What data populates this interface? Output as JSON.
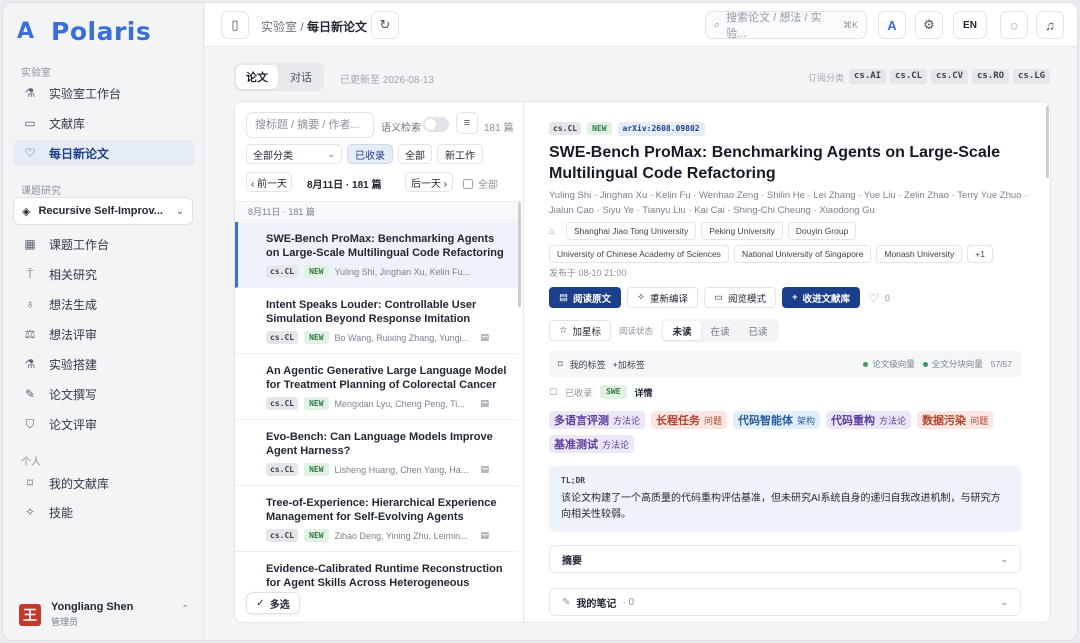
{
  "brand": {
    "name": "Polaris"
  },
  "sidebar": {
    "section_lab": "实验室",
    "lab_items": [
      {
        "label": "实验室工作台"
      },
      {
        "label": "文献库"
      },
      {
        "label": "每日新论文"
      }
    ],
    "section_research": "课题研究",
    "project": "Recursive Self-Improv...",
    "research_items": [
      {
        "label": "课题工作台"
      },
      {
        "label": "相关研究"
      },
      {
        "label": "想法生成"
      },
      {
        "label": "想法评审"
      },
      {
        "label": "实验搭建"
      },
      {
        "label": "论文撰写"
      },
      {
        "label": "论文评审"
      }
    ],
    "section_personal": "个人",
    "personal_items": [
      {
        "label": "我的文献库"
      },
      {
        "label": "技能"
      }
    ],
    "user": {
      "name": "Yongliang Shen",
      "role": "管理员"
    }
  },
  "topbar": {
    "breadcrumb_parent": "实验室",
    "breadcrumb_current": "每日新论文",
    "search_placeholder": "搜索论文 / 想法 / 实验...",
    "search_shortcut": "⌘K",
    "lang": "EN"
  },
  "main": {
    "tabs": [
      "论文",
      "对话"
    ],
    "updated": "已更新至 2026-08-13",
    "subscribed_label": "订阅分类",
    "subscribed": [
      "cs.AI",
      "cs.CL",
      "cs.CV",
      "cs.RO",
      "cs.LG"
    ]
  },
  "list": {
    "filter_placeholder": "搜标题 / 摘要 / 作者...",
    "semantic_label": "语义检索",
    "count": "181 篇",
    "category": "全部分类",
    "pills": [
      "已收录",
      "全部",
      "新工作"
    ],
    "prev_day": "‹ 前一天",
    "day_label": "8月11日 · 181 篇",
    "next_day": "后一天 ›",
    "all_label": "全部",
    "group_header": "8月11日 · 181 篇",
    "collected_button": "多选",
    "items": [
      {
        "title": "SWE-Bench ProMax: Benchmarking Agents on Large-Scale Multilingual Code Refactoring",
        "cat": "cs.CL",
        "tag": "NEW",
        "authors": "Yuling Shi, Jinghan Xu, Kelin Fu..."
      },
      {
        "title": "Intent Speaks Louder: Controllable User Simulation Beyond Response Imitation",
        "cat": "cs.CL",
        "tag": "NEW",
        "authors": "Bo Wang, Ruixing Zhang, Yungi..."
      },
      {
        "title": "An Agentic Generative Large Language Model for Treatment Planning of Colorectal Cancer",
        "cat": "cs.CL",
        "tag": "NEW",
        "authors": "Mengxian Lyu, Cheng Peng, Ti..."
      },
      {
        "title": "Evo-Bench: Can Language Models Improve Agent Harness?",
        "cat": "cs.CL",
        "tag": "NEW",
        "authors": "Lisheng Huang, Chen Yang, Ha..."
      },
      {
        "title": "Tree-of-Experience: Hierarchical Experience Management for Self-Evolving Agents",
        "cat": "cs.CL",
        "tag": "NEW",
        "authors": "Zihao Deng, Yining Zhu, Leimin..."
      },
      {
        "title": "Evidence-Calibrated Runtime Reconstruction for Agent Skills Across Heterogeneous Codin...",
        "cat": "",
        "tag": "",
        "authors": ""
      }
    ]
  },
  "detail": {
    "cat": "cs.CL",
    "tag_new": "NEW",
    "arxiv": "arXiv:2608.09802",
    "title": "SWE-Bench ProMax: Benchmarking Agents on Large-Scale Multilingual Code Refactoring",
    "authors": "Yuling Shi · Jinghan Xu · Kelin Fu · Wenhao Zeng · Shilin He · Lei Zhang · Yue Liu · Zelin Zhao · Terry Yue Zhuo · Jialun Cao · Siyu Ye · Tianyu Liu · Kai Cai · Shing-Chi Cheung · Xiaodong Gu",
    "affiliations": [
      "Shanghai Jiao Tong University",
      "Peking University",
      "Douyin Group",
      "University of Chinese Academy of Sciences",
      "National University of Singapore",
      "Monash University",
      "+1"
    ],
    "published": "发布于 08-10 21:00",
    "actions": {
      "read": "阅读原文",
      "recompile": "重新编译",
      "reader": "阅览模式",
      "add_library": "收进文献库",
      "likes": "0"
    },
    "star": "加星标",
    "read_status_label": "阅读状态",
    "read_status": [
      "未读",
      "在读",
      "已读"
    ],
    "my_tags": "我的标签",
    "add_tag": "+加标签",
    "vec_paper": "论文级向量",
    "vec_chunks": "全文分块向量",
    "chunks_count": "57/57",
    "collected_label": "已收录",
    "collected_tag": "SWE",
    "details_label": "详情",
    "concepts": [
      {
        "name": "多语言评测",
        "kind": "方法论",
        "bg": "#ece6f7",
        "fg": "#5b3f9c"
      },
      {
        "name": "长程任务",
        "kind": "问题",
        "bg": "#fbe6e3",
        "fg": "#b2432f"
      },
      {
        "name": "代码智能体",
        "kind": "架构",
        "bg": "#e2eef9",
        "fg": "#2a5f9e"
      },
      {
        "name": "代码重构",
        "kind": "方法论",
        "bg": "#ece6f7",
        "fg": "#5b3f9c"
      },
      {
        "name": "数据污染",
        "kind": "问题",
        "bg": "#fbe6e3",
        "fg": "#b2432f"
      },
      {
        "name": "基准测试",
        "kind": "方法论",
        "bg": "#ece6f7",
        "fg": "#5b3f9c"
      }
    ],
    "tldr_label": "TL;DR",
    "tldr": "该论文构建了一个高质量的代码重构评估基准，但未研究AI系统自身的递归自我改进机制，与研究方向相关性较弱。",
    "abstract_label": "摘要",
    "notes_label": "我的笔记",
    "notes_count": "0"
  }
}
